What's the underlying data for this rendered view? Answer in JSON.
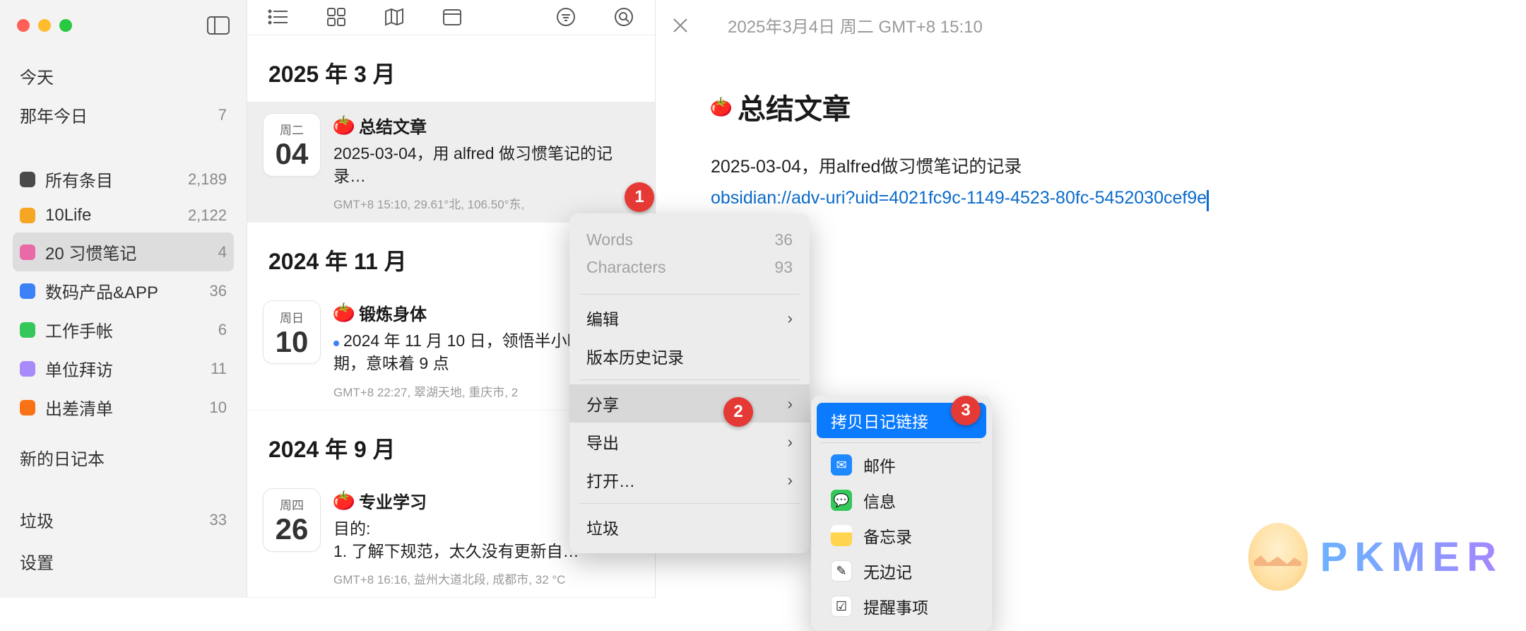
{
  "sidebar": {
    "today": "今天",
    "onThisDay": "那年今日",
    "onThisDayCount": "7",
    "items": [
      {
        "label": "所有条目",
        "count": "2,189",
        "color": "#4a4a4a"
      },
      {
        "label": "10Life",
        "count": "2,122",
        "color": "#f5a623"
      },
      {
        "label": "20 习惯笔记",
        "count": "4",
        "color": "#e86aa6",
        "selected": true
      },
      {
        "label": "数码产品&APP",
        "count": "36",
        "color": "#3b82f6"
      },
      {
        "label": "工作手帐",
        "count": "6",
        "color": "#34c759"
      },
      {
        "label": "单位拜访",
        "count": "11",
        "color": "#a78bfa"
      },
      {
        "label": "出差清单",
        "count": "10",
        "color": "#f97316"
      }
    ],
    "newJournal": "新的日记本",
    "trash": "垃圾",
    "trashCount": "33",
    "settings": "设置"
  },
  "list": {
    "months": [
      {
        "header": "2025 年 3 月",
        "entries": [
          {
            "dow": "周二",
            "day": "04",
            "title": "总结文章",
            "snippet": "2025-03-04，用 alfred 做习惯笔记的记录…",
            "meta": "GMT+8 15:10,   29.61°北, 106.50°东,",
            "selected": true
          }
        ]
      },
      {
        "header": "2024 年 11 月",
        "entries": [
          {
            "dow": "周日",
            "day": "10",
            "title": "锻炼身体",
            "snippet": "2024 年 11 月 10 日，领悟半小时准备期，意味着 9 点",
            "meta": "GMT+8 22:27,   翠湖天地, 重庆市,   2",
            "bullet": true
          }
        ]
      },
      {
        "header": "2024 年 9 月",
        "entries": [
          {
            "dow": "周四",
            "day": "26",
            "title": "专业学习",
            "snippet": "目的:\n1. 了解下规范，太久没有更新自…",
            "meta": "GMT+8 16:16,   益州大道北段, 成都市,   32 °C"
          }
        ]
      }
    ]
  },
  "main": {
    "timestamp": "2025年3月4日 周二 GMT+8 15:10",
    "title": "总结文章",
    "body": "2025-03-04，用alfred做习惯笔记的记录",
    "link": "obsidian://adv-uri?uid=4021fc9c-1149-4523-80fc-5452030cef9e"
  },
  "ctx": {
    "wordsLabel": "Words",
    "wordsVal": "36",
    "charsLabel": "Characters",
    "charsVal": "93",
    "edit": "编辑",
    "history": "版本历史记录",
    "share": "分享",
    "export": "导出",
    "open": "打开…",
    "trash": "垃圾"
  },
  "share": {
    "copyLink": "拷贝日记链接",
    "mail": "邮件",
    "messages": "信息",
    "notes": "备忘录",
    "freeform": "无边记",
    "reminders": "提醒事项"
  },
  "badges": {
    "b1": "1",
    "b2": "2",
    "b3": "3"
  },
  "watermark": "PKMER"
}
